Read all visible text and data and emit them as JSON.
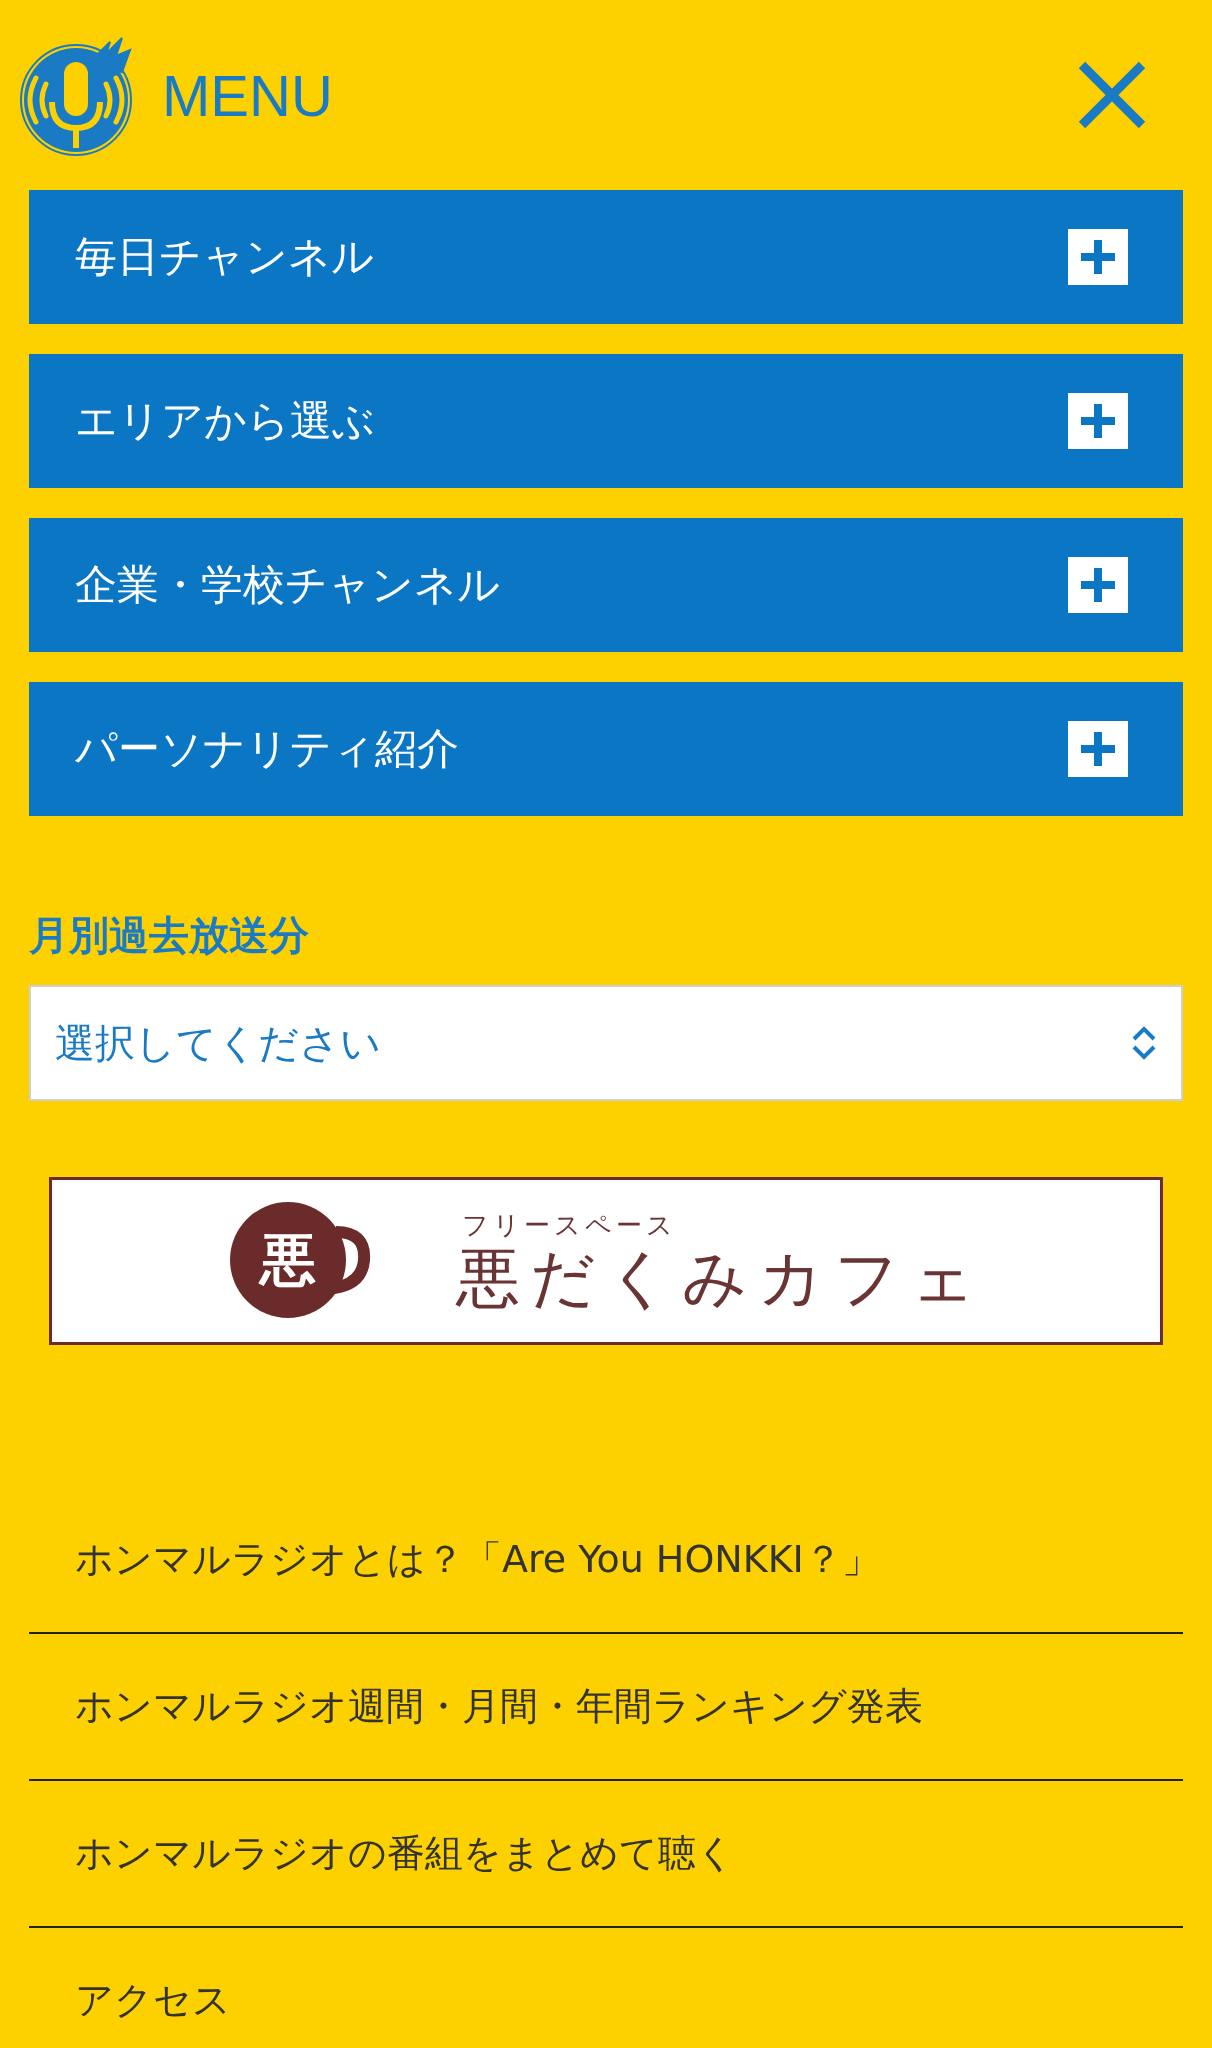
{
  "header": {
    "title": "MENU"
  },
  "accordion": [
    {
      "label": "毎日チャンネル",
      "expanded": false
    },
    {
      "label": "エリアから選ぶ",
      "expanded": false
    },
    {
      "label": "企業・学校チャンネル",
      "expanded": false
    },
    {
      "label": "パーソナリティ紹介",
      "expanded": false
    }
  ],
  "archive": {
    "heading": "月別過去放送分",
    "select": {
      "value": "選択してください"
    }
  },
  "banner": {
    "mug_text": "悪",
    "subtitle": "フリースペース",
    "title": "悪だくみカフェ"
  },
  "links": [
    "ホンマルラジオとは？「Are You HONKKI？」",
    "ホンマルラジオ週間・月間・年間ランキング発表",
    "ホンマルラジオの番組をまとめて聴く",
    "アクセス"
  ]
}
